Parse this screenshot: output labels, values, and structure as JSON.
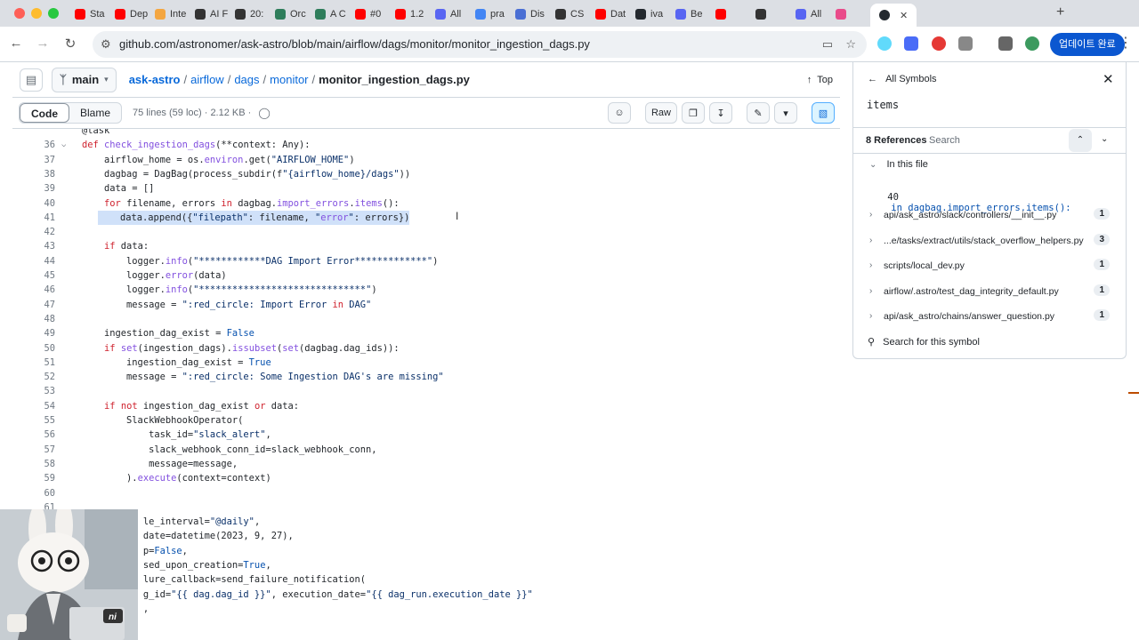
{
  "tabs": [
    {
      "title": "Sta",
      "color": "#ff0000"
    },
    {
      "title": "Dep",
      "color": "#ff0000"
    },
    {
      "title": "Inte",
      "color": "#f4a640"
    },
    {
      "title": "AI F",
      "color": "#333333"
    },
    {
      "title": "20:",
      "color": "#333333"
    },
    {
      "title": "Orc",
      "color": "#2e7d5b"
    },
    {
      "title": "A C",
      "color": "#2e7d5b"
    },
    {
      "title": "#0",
      "color": "#ff0000"
    },
    {
      "title": "1.2",
      "color": "#ff0000"
    },
    {
      "title": "All",
      "color": "#5865f2"
    },
    {
      "title": "pra",
      "color": "#4285f4"
    },
    {
      "title": "Dis",
      "color": "#4a6fd4"
    },
    {
      "title": "CS",
      "color": "#333333"
    },
    {
      "title": "Dat",
      "color": "#ff0000"
    },
    {
      "title": "iva",
      "color": "#24292f"
    },
    {
      "title": "Be",
      "color": "#5865f2"
    },
    {
      "title": "",
      "color": "#ff0000"
    },
    {
      "title": "",
      "color": "#333333"
    },
    {
      "title": "All",
      "color": "#5865f2"
    },
    {
      "title": "",
      "color": "#e94b8a"
    }
  ],
  "address": {
    "url": "github.com/astronomer/ask-astro/blob/main/airflow/dags/monitor/monitor_ingestion_dags.py"
  },
  "update_button": "업데이트 완료",
  "file_header": {
    "branch": "main",
    "crumbs": [
      "ask-astro",
      "airflow",
      "dags",
      "monitor"
    ],
    "current": "monitor_ingestion_dags.py",
    "top_label": "Top"
  },
  "toolbar": {
    "code_tab": "Code",
    "blame_tab": "Blame",
    "meta": "75 lines (59 loc) · 2.12 KB ·",
    "raw": "Raw"
  },
  "code_lines": [
    {
      "n": "",
      "t": "@task"
    },
    {
      "n": "36",
      "t": "def check_ingestion_dags(**context: Any):",
      "fold": true
    },
    {
      "n": "37",
      "t": "    airflow_home = os.environ.get(\"AIRFLOW_HOME\")"
    },
    {
      "n": "38",
      "t": "    dagbag = DagBag(process_subdir(f\"{airflow_home}/dags\"))"
    },
    {
      "n": "39",
      "t": "    data = []"
    },
    {
      "n": "40",
      "t": "    for filename, errors in dagbag.import_errors.items():"
    },
    {
      "n": "41",
      "t": "        data.append({\"filepath\": filename, \"error\": errors})",
      "hl": true
    },
    {
      "n": "42",
      "t": ""
    },
    {
      "n": "43",
      "t": "    if data:"
    },
    {
      "n": "44",
      "t": "        logger.info(\"************DAG Import Error*************\")"
    },
    {
      "n": "45",
      "t": "        logger.error(data)"
    },
    {
      "n": "46",
      "t": "        logger.info(\"******************************\")"
    },
    {
      "n": "47",
      "t": "        message = \":red_circle: Import Error in DAG\""
    },
    {
      "n": "48",
      "t": ""
    },
    {
      "n": "49",
      "t": "    ingestion_dag_exist = False"
    },
    {
      "n": "50",
      "t": "    if set(ingestion_dags).issubset(set(dagbag.dag_ids)):"
    },
    {
      "n": "51",
      "t": "        ingestion_dag_exist = True"
    },
    {
      "n": "52",
      "t": "        message = \":red_circle: Some Ingestion DAG's are missing\""
    },
    {
      "n": "53",
      "t": ""
    },
    {
      "n": "54",
      "t": "    if not ingestion_dag_exist or data:"
    },
    {
      "n": "55",
      "t": "        SlackWebhookOperator("
    },
    {
      "n": "56",
      "t": "            task_id=\"slack_alert\","
    },
    {
      "n": "57",
      "t": "            slack_webhook_conn_id=slack_webhook_conn,"
    },
    {
      "n": "58",
      "t": "            message=message,"
    },
    {
      "n": "59",
      "t": "        ).execute(context=context)"
    },
    {
      "n": "60",
      "t": ""
    },
    {
      "n": "61",
      "t": ""
    },
    {
      "n": "",
      "t": "           le_interval=\"@daily\","
    },
    {
      "n": "",
      "t": "           date=datetime(2023, 9, 27),"
    },
    {
      "n": "",
      "t": "           p=False,"
    },
    {
      "n": "",
      "t": "           sed_upon_creation=True,"
    },
    {
      "n": "",
      "t": "           lure_callback=send_failure_notification("
    },
    {
      "n": "",
      "t": "           g_id=\"{{ dag.dag_id }}\", execution_date=\"{{ dag_run.execution_date }}\""
    },
    {
      "n": "",
      "t": "           ,"
    }
  ],
  "symbols": {
    "back_label": "All Symbols",
    "symbol": "items",
    "refs_label": "8 References",
    "search_label": "Search",
    "in_file": "In this file",
    "in_file_ref": {
      "line": "40",
      "text": "in dagbag.import_errors.items():"
    },
    "refs": [
      {
        "path": "api/ask_astro/slack/controllers/__init__.py",
        "count": "1"
      },
      {
        "path": "...e/tasks/extract/utils/stack_overflow_helpers.py",
        "count": "3"
      },
      {
        "path": "scripts/local_dev.py",
        "count": "1"
      },
      {
        "path": "airflow/.astro/test_dag_integrity_default.py",
        "count": "1"
      },
      {
        "path": "api/ask_astro/chains/answer_question.py",
        "count": "1"
      }
    ],
    "search_symbol": "Search for this symbol"
  },
  "avatar_badge": "ni"
}
